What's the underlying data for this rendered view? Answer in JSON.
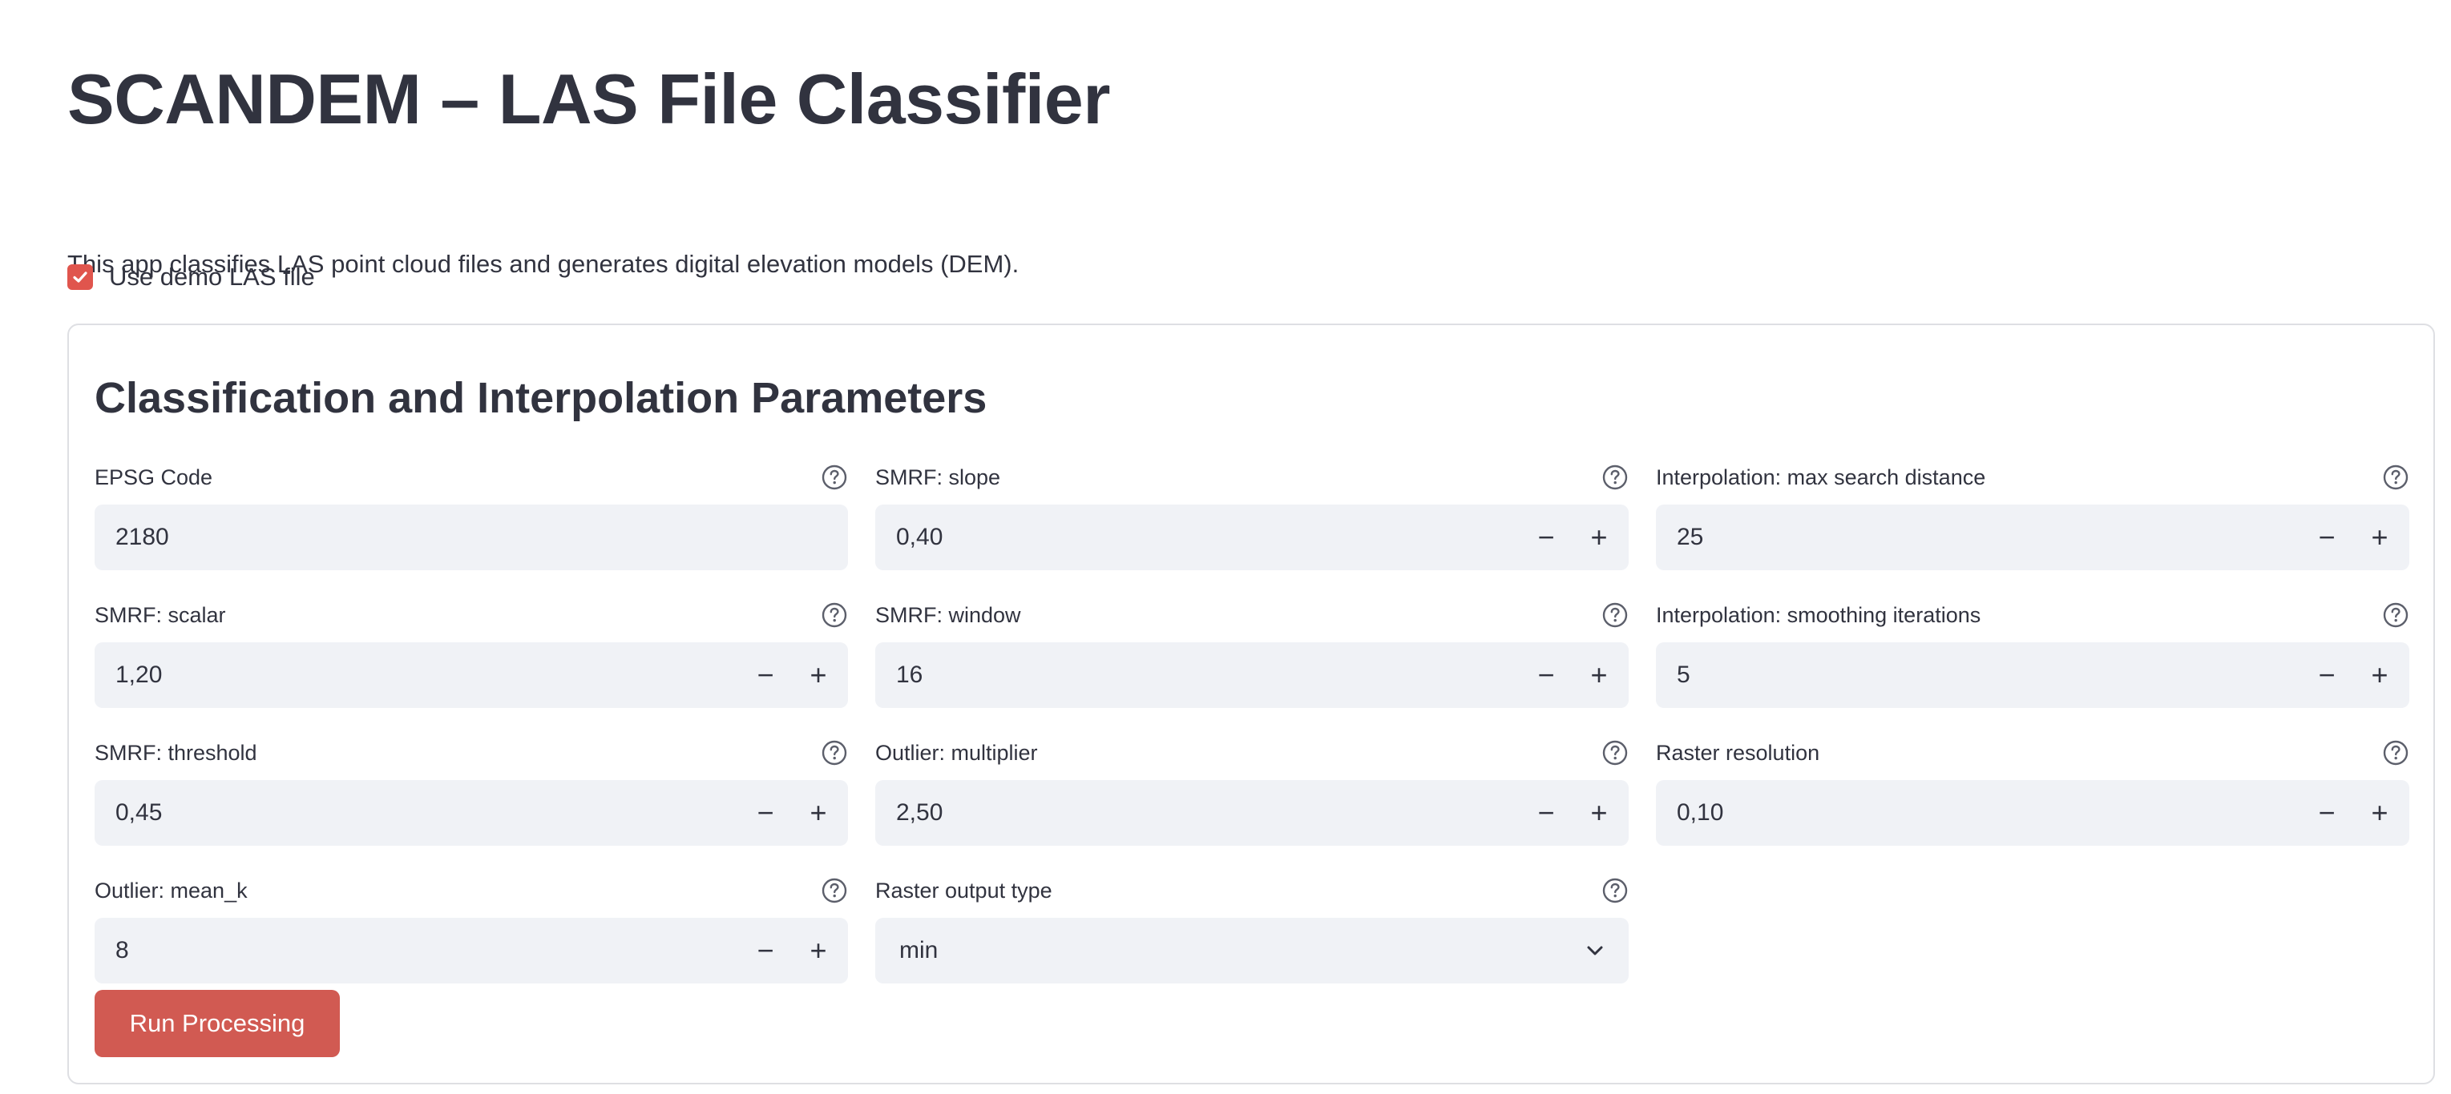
{
  "header": {
    "title": "SCANDEM – LAS File Classifier",
    "description": "This app classifies LAS point cloud files and generates digital elevation models (DEM)."
  },
  "demo_checkbox": {
    "label": "Use demo LAS file",
    "checked": true
  },
  "form": {
    "title": "Classification and Interpolation Parameters",
    "fields": {
      "epsg": {
        "label": "EPSG Code",
        "value": "2180"
      },
      "smrf_slope": {
        "label": "SMRF: slope",
        "value": "0,40"
      },
      "interp_max_dist": {
        "label": "Interpolation: max search distance",
        "value": "25"
      },
      "smrf_scalar": {
        "label": "SMRF: scalar",
        "value": "1,20"
      },
      "smrf_window": {
        "label": "SMRF: window",
        "value": "16"
      },
      "interp_smoothing": {
        "label": "Interpolation: smoothing iterations",
        "value": "5"
      },
      "smrf_threshold": {
        "label": "SMRF: threshold",
        "value": "0,45"
      },
      "outlier_multiplier": {
        "label": "Outlier: multiplier",
        "value": "2,50"
      },
      "raster_resolution": {
        "label": "Raster resolution",
        "value": "0,10"
      },
      "outlier_mean_k": {
        "label": "Outlier: mean_k",
        "value": "8"
      },
      "raster_output_type": {
        "label": "Raster output type",
        "value": "min"
      }
    },
    "stepper": {
      "minus": "−",
      "plus": "+"
    },
    "run_button": "Run Processing"
  },
  "colors": {
    "accent": "#d15a52",
    "checkbox": "#e0554d",
    "input_bg": "#f0f2f6",
    "text": "#31333f",
    "border": "#dedfe3"
  }
}
